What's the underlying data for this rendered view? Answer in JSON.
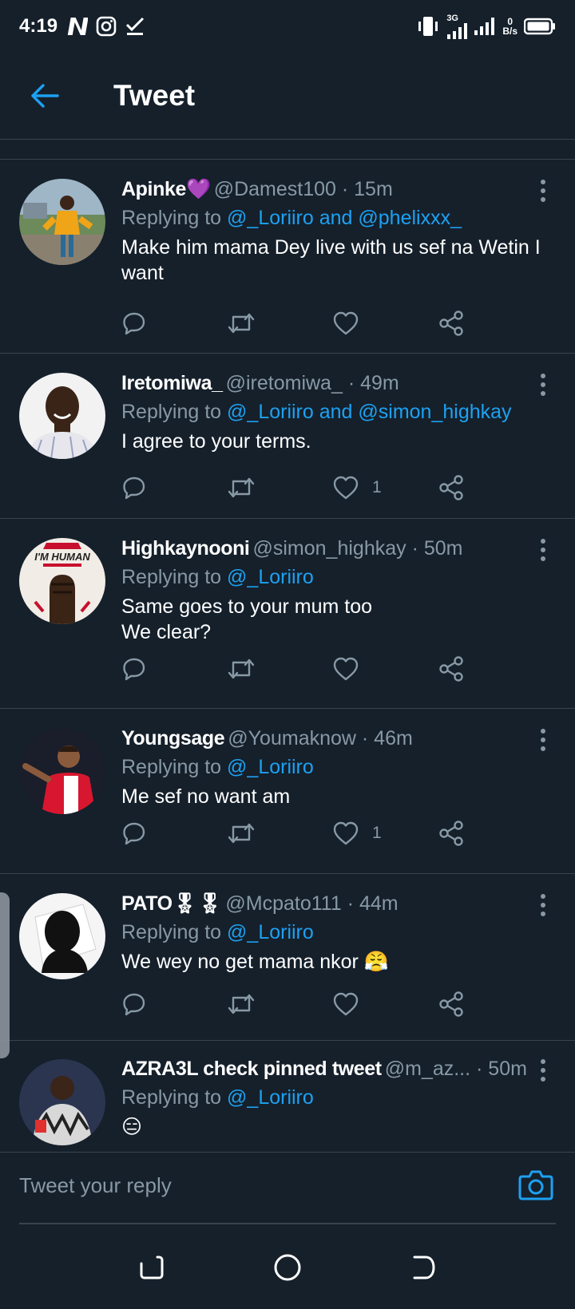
{
  "status_bar": {
    "time": "4:19",
    "network": "3G",
    "speed_value": "0",
    "speed_unit": "B/s"
  },
  "header": {
    "title": "Tweet"
  },
  "tweets": [
    {
      "name": "Apinke💜",
      "handle": "@Damest100",
      "time": " · 15m",
      "replying_prefix": "Replying to ",
      "replying_to": "@_Loriiro and @phelixxx_",
      "text": "Make him mama Dey live with us sef na Wetin I want",
      "like_count": ""
    },
    {
      "name": "Iretomiwa_",
      "handle": "@iretomiwa_",
      "time": " · 49m",
      "replying_prefix": "Replying to ",
      "replying_to": "@_Loriiro and @simon_highkay",
      "text": "I agree to your terms.",
      "like_count": "1"
    },
    {
      "name": "Highkaynooni",
      "handle": "@simon_highkay",
      "time": " · 50m",
      "replying_prefix": "Replying to ",
      "replying_to": "@_Loriiro",
      "text": "Same goes to your mum too\nWe clear?",
      "like_count": "",
      "avatar_text": "I'M HUMAN"
    },
    {
      "name": "Youngsage",
      "handle": "@Youmaknow",
      "time": " · 46m",
      "replying_prefix": "Replying to ",
      "replying_to": "@_Loriiro",
      "text": "Me sef no want am",
      "like_count": "1"
    },
    {
      "name": "PATO🎖🎖",
      "handle": "@Mcpato111",
      "time": " · 44m",
      "replying_prefix": "Replying to ",
      "replying_to": "@_Loriiro",
      "text": "We wey no get mama nkor 😤",
      "like_count": ""
    },
    {
      "name": "AZRA3L check pinned tweet",
      "handle": "@m_az...",
      "time": " · 50m",
      "replying_prefix": "Replying to ",
      "replying_to": "@_Loriiro",
      "text": "😑",
      "like_count": ""
    }
  ],
  "reply": {
    "placeholder": "Tweet your reply"
  },
  "colors": {
    "background": "#15202b",
    "accent": "#1da1f2",
    "secondary_text": "#8899a6",
    "divider": "#38444d"
  },
  "icons": [
    "back-arrow-icon",
    "reply-icon",
    "retweet-icon",
    "like-icon",
    "share-icon",
    "more-icon",
    "camera-icon",
    "recents-icon",
    "home-icon",
    "back-nav-icon"
  ]
}
